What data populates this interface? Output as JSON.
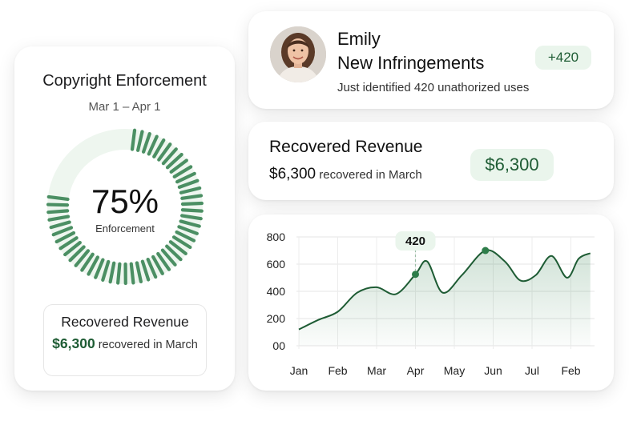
{
  "colors": {
    "accent": "#2e7d4a",
    "accent_light": "#eaf5ec",
    "accent_dark": "#1e5c34"
  },
  "enforcement_card": {
    "title": "Copyright Enforcement",
    "date_range": "Mar 1 – Apr 1",
    "gauge_value": "75%",
    "gauge_label": "Enforcement",
    "gauge_fraction": 0.75,
    "mini_card": {
      "title": "Recovered Revenue",
      "amount": "$6,300",
      "text": "recovered in March"
    }
  },
  "notification_card": {
    "avatar_icon": "person-avatar",
    "name": "Emily",
    "title": "New Infringements",
    "subtitle": "Just identified 420 unathorized uses",
    "badge": "+420"
  },
  "revenue_card": {
    "title": "Recovered Revenue",
    "amount": "$6,300",
    "text": "recovered in March",
    "badge": "$6,300"
  },
  "chart_data": {
    "type": "area",
    "categories": [
      "Jan",
      "Feb",
      "Mar",
      "Apr",
      "May",
      "Jun",
      "Jul",
      "Feb"
    ],
    "y_ticks": [
      "800",
      "600",
      "400",
      "200",
      "00"
    ],
    "ylim": [
      0,
      800
    ],
    "grid": true,
    "series": [
      {
        "x": [
          0,
          0.5,
          1.0,
          1.5,
          2.0,
          2.5,
          3.0,
          3.3,
          3.7,
          4.2,
          4.8,
          5.3,
          5.7,
          6.1,
          6.5,
          6.9,
          7.2,
          7.5
        ],
        "values": [
          120,
          190,
          250,
          390,
          430,
          380,
          525,
          620,
          390,
          520,
          700,
          620,
          480,
          520,
          660,
          500,
          640,
          680
        ]
      }
    ],
    "highlight": {
      "x": 3.0,
      "value": 525,
      "label": "420"
    },
    "markers": [
      {
        "x": 4.8,
        "value": 700
      }
    ]
  }
}
